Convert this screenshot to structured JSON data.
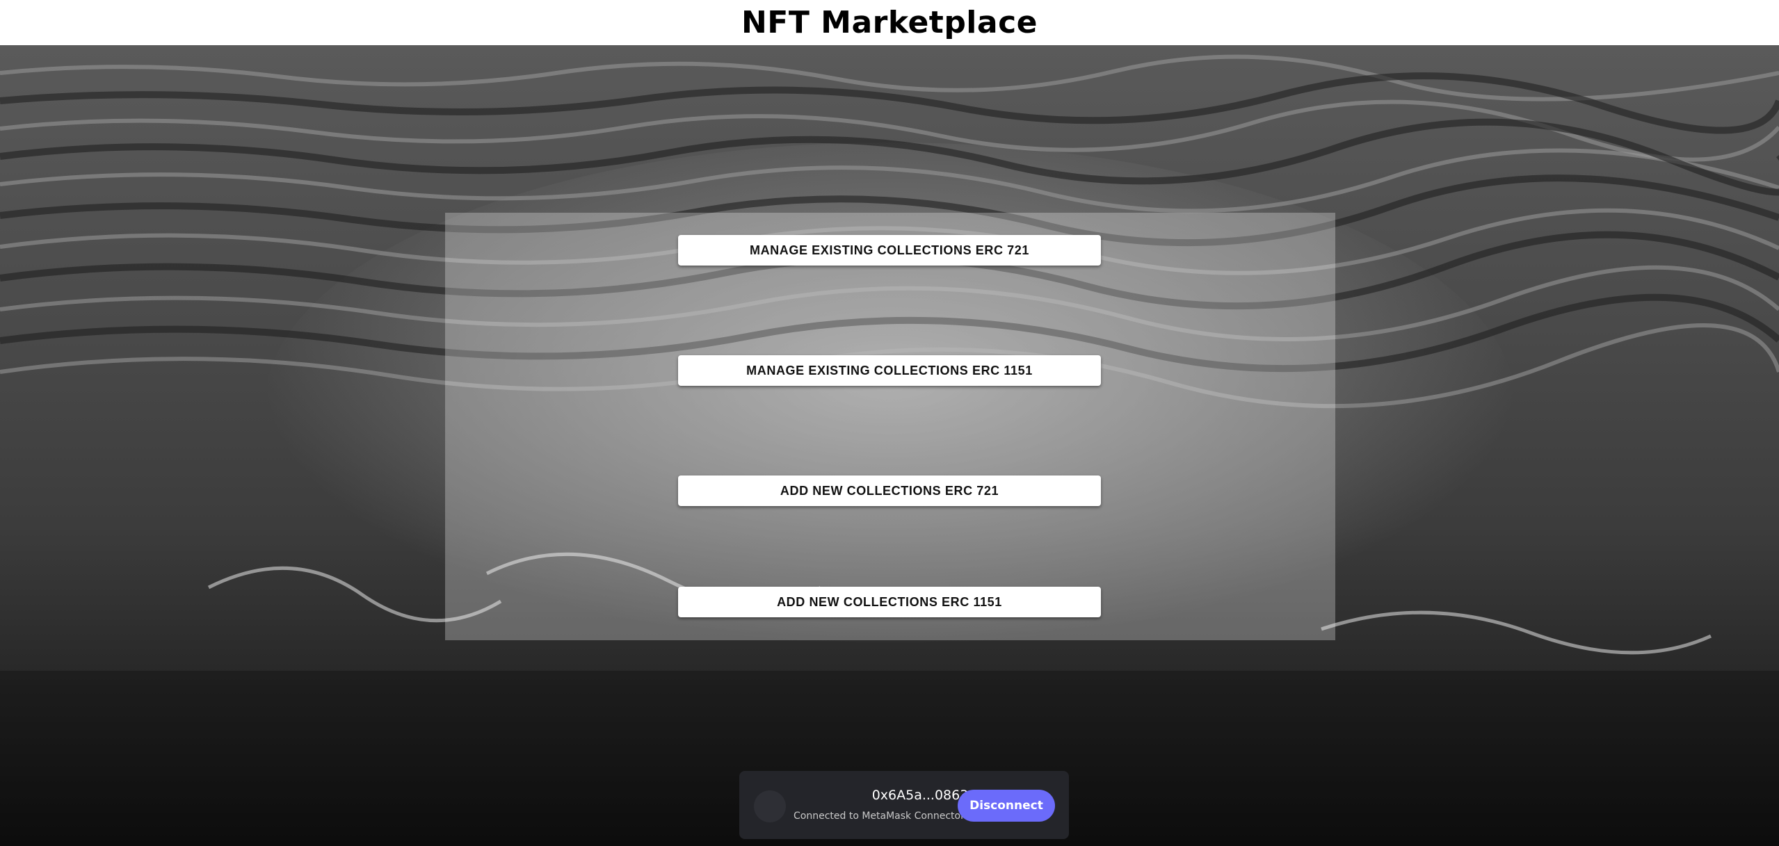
{
  "header": {
    "title": "NFT Marketplace"
  },
  "menu": {
    "manage_721": "MANAGE EXISTING COLLECTIONS ERC 721",
    "manage_1151": "MANAGE EXISTING COLLECTIONS ERC 1151",
    "add_721": "ADD NEW COLLECTIONS ERC 721",
    "add_1151": "ADD NEW COLLECTIONS ERC 1151"
  },
  "wallet": {
    "address": "0x6A5a...0863",
    "connector_text": "Connected to MetaMask Connector",
    "disconnect_label": "Disconnect",
    "avatar_icon": "wallet-avatar-icon"
  },
  "colors": {
    "disconnect_button": "#6b6bfa",
    "wallet_bar": "#24252a",
    "header_bg": "#ffffff"
  }
}
